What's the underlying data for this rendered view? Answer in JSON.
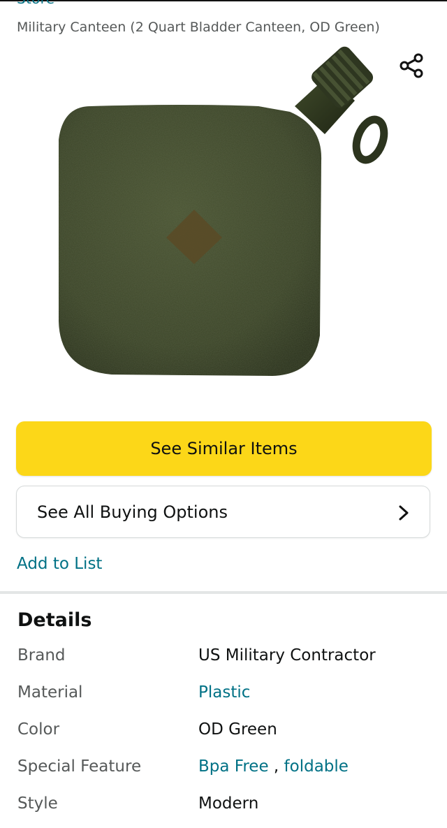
{
  "store_link": "Store",
  "product": {
    "title": "Military Canteen (2 Quart Bladder Canteen, OD Green)"
  },
  "buttons": {
    "see_similar": "See Similar Items",
    "see_all_buying_options": "See All Buying Options",
    "add_to_list": "Add to List"
  },
  "details": {
    "heading": "Details",
    "brand_label": "Brand",
    "brand_value": "US Military Contractor",
    "material_label": "Material",
    "material_value": "Plastic",
    "color_label": "Color",
    "color_value": "OD Green",
    "special_feature_label": "Special Feature",
    "special_feature_value_1": "Bpa Free",
    "special_feature_separator": ",",
    "special_feature_value_2": "foldable",
    "style_label": "Style",
    "style_value": "Modern"
  },
  "icons": {
    "share": "share-icon",
    "chevron": "chevron-right-icon"
  },
  "colors": {
    "primary_button": "#fcd718",
    "link": "#007185",
    "canteen": "#3a4327"
  }
}
